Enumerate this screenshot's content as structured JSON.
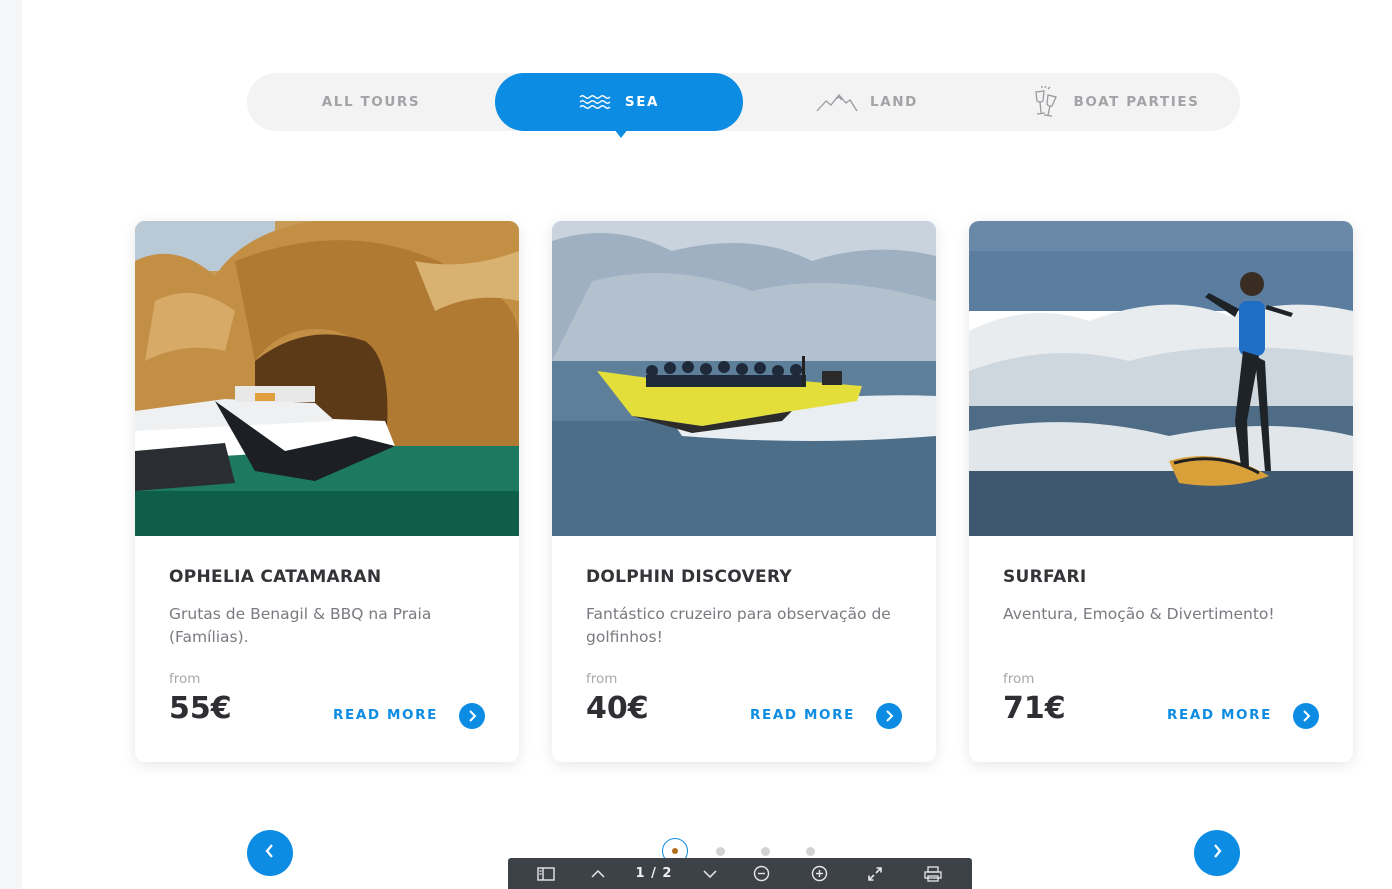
{
  "tabs": [
    {
      "label": "ALL TOURS",
      "active": false,
      "icon": ""
    },
    {
      "label": "SEA",
      "active": true,
      "icon": "waves-icon"
    },
    {
      "label": "LAND",
      "active": false,
      "icon": "mountains-icon"
    },
    {
      "label": "BOAT PARTIES",
      "active": false,
      "icon": "champagne-glasses-icon"
    }
  ],
  "cards": [
    {
      "title": "OPHELIA CATAMARAN",
      "description": "Grutas de Benagil & BBQ na Praia (Famílias).",
      "from_label": "from",
      "price": "55€",
      "read_more": "READ MORE",
      "image": "catamaran-cave-photo"
    },
    {
      "title": "DOLPHIN DISCOVERY",
      "description": "Fantástico cruzeiro para observação de golfinhos!",
      "from_label": "from",
      "price": "40€",
      "read_more": "READ MORE",
      "image": "speedboat-photo"
    },
    {
      "title": "SURFARI",
      "description": "Aventura, Emoção & Divertimento!",
      "from_label": "from",
      "price": "71€",
      "read_more": "READ MORE",
      "image": "surfer-photo"
    }
  ],
  "slider": {
    "dots": 4,
    "active_dot": 0,
    "prev_icon": "chevron-left-icon",
    "next_icon": "chevron-right-icon"
  },
  "viewer": {
    "page_indicator": "1 / 2"
  },
  "colors": {
    "accent": "#0c8de3",
    "tab_bg": "#f3f3f4",
    "title": "#333338",
    "toolbar": "#3d4148"
  }
}
